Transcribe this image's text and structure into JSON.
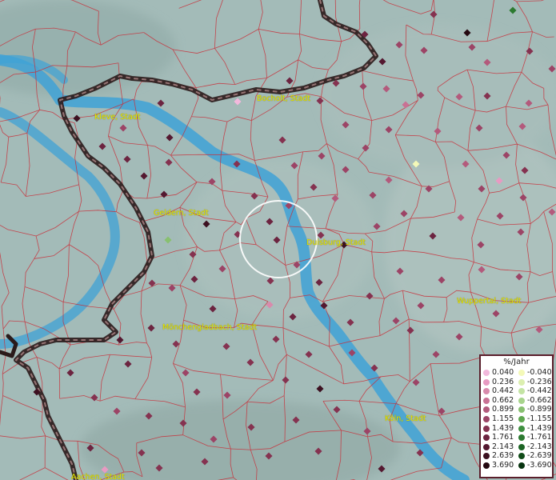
{
  "cities": [
    {
      "name": "Bocholt, Stadt"
    },
    {
      "name": "Kleve, Stadt"
    },
    {
      "name": "Geldern, Stadt"
    },
    {
      "name": "Duisburg, Stadt"
    },
    {
      "name": "Mönchengladbach, Stadt"
    },
    {
      "name": "Wuppertal, Stadt"
    },
    {
      "name": "Köln, Stadt"
    },
    {
      "name": "Aachen, Stadt"
    }
  ],
  "legend": {
    "title": "%/Jahr",
    "rows": [
      {
        "pos": "0.040",
        "neg": "-0.040",
        "pos_color": "#f2b8dc",
        "neg_color": "#f4f9b8"
      },
      {
        "pos": "0.236",
        "neg": "-0.236",
        "pos_color": "#e89ac2",
        "neg_color": "#dcefb0"
      },
      {
        "pos": "0.442",
        "neg": "-0.442",
        "pos_color": "#d98aac",
        "neg_color": "#c4e4a4"
      },
      {
        "pos": "0.662",
        "neg": "-0.662",
        "pos_color": "#c97194",
        "neg_color": "#a8d48c"
      },
      {
        "pos": "0.899",
        "neg": "-0.899",
        "pos_color": "#b35a7c",
        "neg_color": "#88c070"
      },
      {
        "pos": "1.155",
        "neg": "-1.155",
        "pos_color": "#9c4466",
        "neg_color": "#5fa850"
      },
      {
        "pos": "1.439",
        "neg": "-1.439",
        "pos_color": "#853250",
        "neg_color": "#3f9040"
      },
      {
        "pos": "1.761",
        "neg": "-1.761",
        "pos_color": "#6c2440",
        "neg_color": "#2c7a30"
      },
      {
        "pos": "2.143",
        "neg": "-2.143",
        "pos_color": "#541830",
        "neg_color": "#1c6424"
      },
      {
        "pos": "2.639",
        "neg": "-2.639",
        "pos_color": "#3c1020",
        "neg_color": "#104c18"
      },
      {
        "pos": "3.690",
        "neg": "-3.690",
        "pos_color": "#240810",
        "neg_color": "#083410"
      }
    ]
  }
}
